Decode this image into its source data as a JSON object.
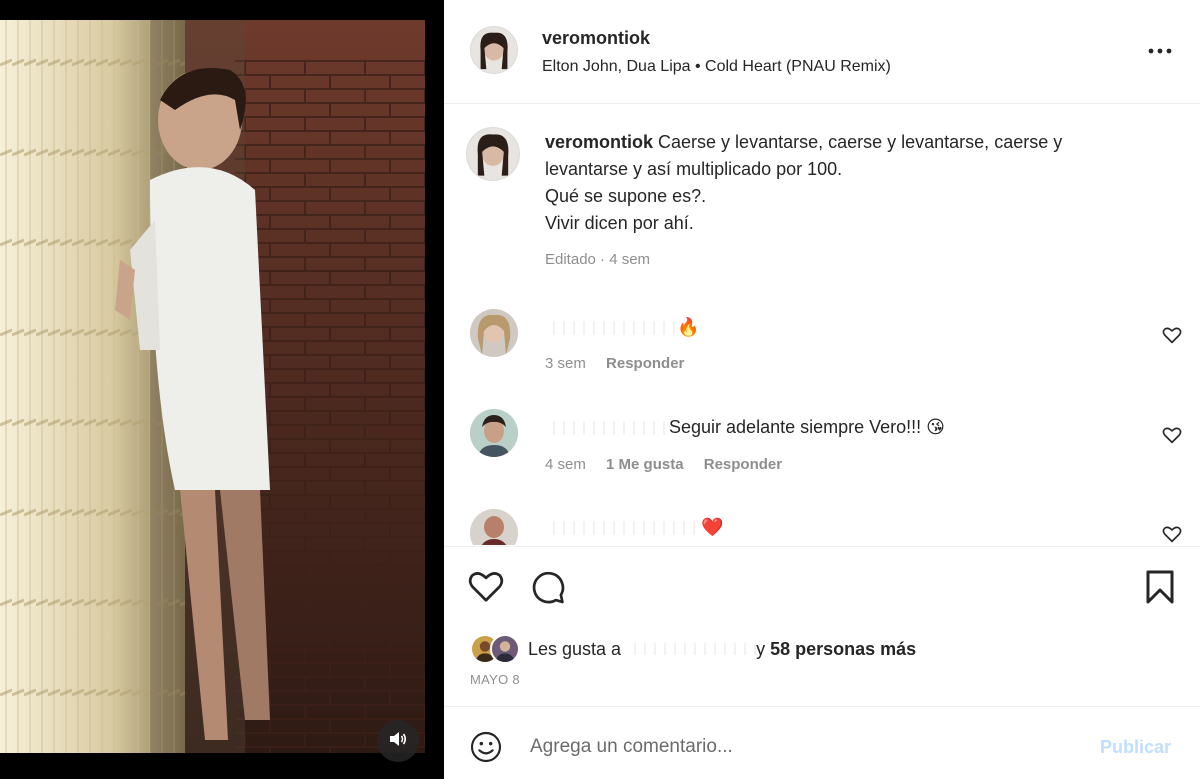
{
  "post": {
    "username": "veromontiok",
    "music": "Elton John, Dua Lipa • Cold Heart (PNAU Remix)"
  },
  "caption": {
    "username": "veromontiok",
    "text_line1": " Caerse y levantarse, caerse y levantarse, caerse y levantarse y así multiplicado por 100.",
    "text_line2": "Qué se supone es?.",
    "text_line3": "Vivir dicen por ahí.",
    "meta": "Editado · 4 sem"
  },
  "comments": [
    {
      "text": "🔥",
      "time": "3 sem",
      "reply": "Responder"
    },
    {
      "text": "Seguir adelante siempre Vero!!! 😘",
      "time": "4 sem",
      "likes": "1 Me gusta",
      "reply": "Responder"
    },
    {
      "text": "❤️"
    }
  ],
  "likes": {
    "prefix": "Les gusta a ",
    "connector": "y ",
    "count_text": "58 personas más"
  },
  "date": "MAYO 8",
  "add_comment": {
    "placeholder": "Agrega un comentario...",
    "publish_label": "Publicar"
  },
  "icons": {
    "more": "more-horizontal-icon",
    "like": "heart-icon",
    "comment": "comment-bubble-icon",
    "save": "bookmark-icon",
    "emoji": "smiley-icon",
    "sound": "speaker-icon"
  },
  "colors": {
    "publish_disabled": "#c0dffd",
    "secondary_text": "#8e8e8e",
    "primary_text": "#262626"
  }
}
